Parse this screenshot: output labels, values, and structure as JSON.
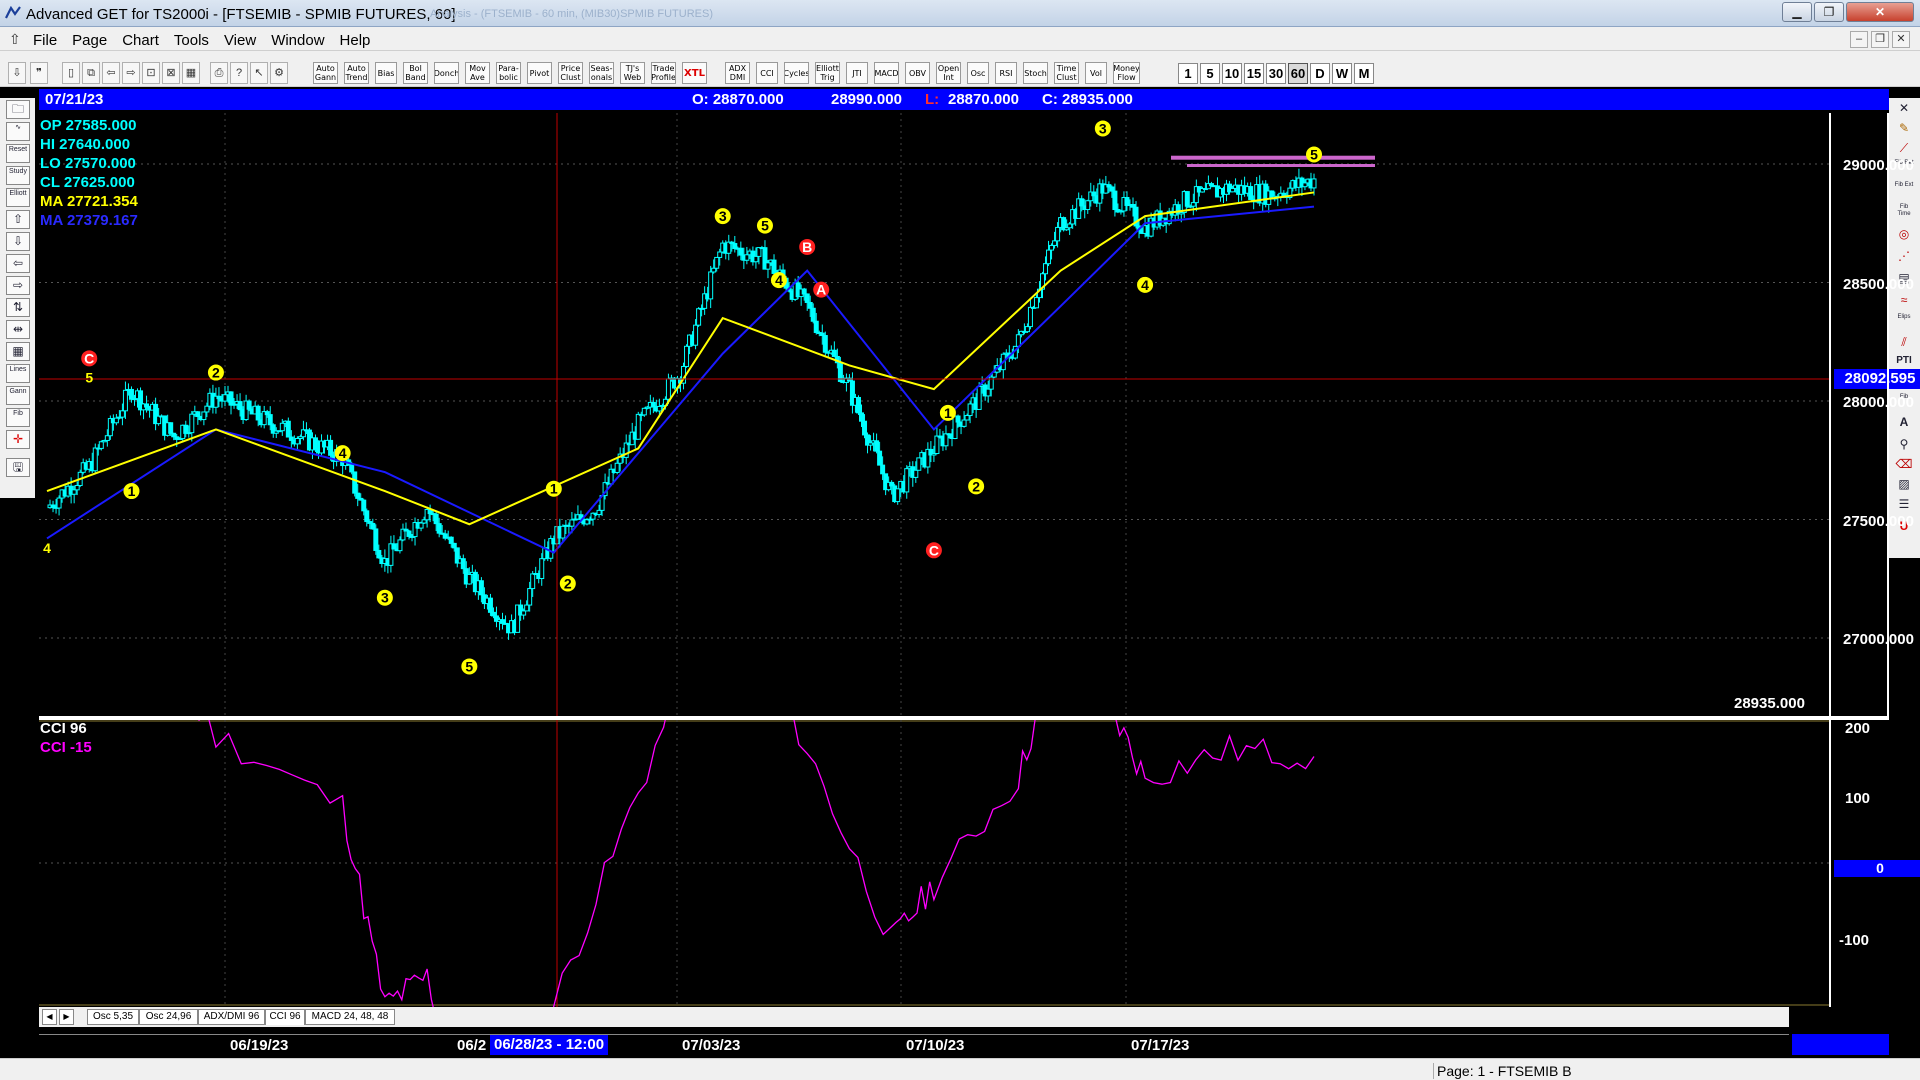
{
  "window": {
    "title": "Advanced GET for TS2000i - [FTSEMIB - SPMIB FUTURES, 60]",
    "ghost_title": "Analysis - (FTSEMIB - 60 min, (MIB30)SPMIB FUTURES)"
  },
  "menu": [
    "File",
    "Page",
    "Chart",
    "Tools",
    "View",
    "Window",
    "Help"
  ],
  "toolbar": {
    "study_buttons": [
      "Auto Gann",
      "Auto Trend",
      "Bias",
      "Bol Band",
      "Donch",
      "Mov Ave",
      "Para-bolic",
      "Pivot",
      "Price Clust",
      "Seas-onals",
      "TJ's Web",
      "Trade Profile",
      "XTL",
      "ADX DMI",
      "CCI",
      "Cycles",
      "Elliott Trig",
      "JTI",
      "MACD",
      "OBV",
      "Open Int",
      "Osc",
      "RSI",
      "Stoch",
      "Time Clust",
      "Vol",
      "Money Flow"
    ],
    "timeframes": [
      "1",
      "5",
      "10",
      "15",
      "30",
      "60",
      "D",
      "W",
      "M"
    ],
    "active_timeframe": "60"
  },
  "left_tools": [
    "Elliott",
    "Reset",
    "Study",
    "Lines",
    "Gann",
    "Fib"
  ],
  "right_tools": [
    "Fib Ret",
    "Fib Ext",
    "Fib Time",
    "Elips",
    "PTI",
    "Fib",
    "A",
    "U"
  ],
  "header": {
    "date": "07/21/23",
    "open": "O: 28870.000",
    "high": "28990.000",
    "low_prefix": "L:",
    "low": "28870.000",
    "close": "C: 28935.000"
  },
  "ohlc_readout": {
    "op": "OP  27585.000",
    "hi": "HI   27640.000",
    "lo": "LO  27570.000",
    "cl": "CL  27625.000",
    "ma_yellow": "MA  27721.354",
    "ma_blue": "MA  27379.167"
  },
  "price_axis": {
    "labels": [
      "29000.000",
      "28500.000",
      "28000.000",
      "27500.000",
      "27000.000"
    ],
    "crosshair_price": "28092.595",
    "last_close": "28935.000"
  },
  "indicator": {
    "title_1": "CCI 96",
    "title_2": "CCI  -15",
    "axis_labels": [
      "200",
      "100",
      "-100"
    ],
    "zero_label": "0"
  },
  "tabs": {
    "nav_prev": "◀",
    "nav_next": "▶",
    "items": [
      "Osc 5,35",
      "Osc 24,96",
      "ADX/DMI 96",
      "CCI 96",
      "MACD 24, 48, 48"
    ],
    "active": "CCI 96"
  },
  "date_axis": {
    "labels": [
      "06/19/23",
      "06/2",
      "07/03/23",
      "07/10/23",
      "07/17/23"
    ],
    "cursor": "06/28/23 - 12:00"
  },
  "status": {
    "page": "Page: 1 - FTSEMIB B"
  },
  "colors": {
    "background": "#000000",
    "price_bars": "#00ffff",
    "ma_fast": "#ffff00",
    "ma_slow": "#1a1aff",
    "cci": "#ff00ff",
    "header": "#0000ff",
    "elliott_labels": "#ffff00",
    "abc_labels": "#ff2020"
  },
  "chart_data": {
    "type": "candlestick",
    "symbol": "FTSEMIB",
    "interval": "60",
    "y_axis_ticks": [
      29000,
      28500,
      28000,
      27500,
      27000
    ],
    "x_axis_ticks": [
      "06/19/23",
      "07/03/23",
      "07/10/23",
      "07/17/23"
    ],
    "price_path": [
      [
        "06/14/23",
        27550
      ],
      [
        "06/15/23",
        27720
      ],
      [
        "06/16/23",
        28050
      ],
      [
        "06/16/23b",
        27850
      ],
      [
        "06/19/23",
        28020
      ],
      [
        "06/20/23",
        27930
      ],
      [
        "06/21/23",
        27850
      ],
      [
        "06/22/23",
        27760
      ],
      [
        "06/23/23",
        27320
      ],
      [
        "06/26/23",
        27550
      ],
      [
        "06/27/23",
        27250
      ],
      [
        "06/27/23b",
        27040
      ],
      [
        "06/28/23",
        27420
      ],
      [
        "06/29/23",
        27550
      ],
      [
        "06/30/23",
        27900
      ],
      [
        "07/01/23",
        28120
      ],
      [
        "07/03/23",
        28660
      ],
      [
        "07/04/23",
        28600
      ],
      [
        "07/05/23",
        28400
      ],
      [
        "07/06/23",
        28050
      ],
      [
        "07/07/23",
        27600
      ],
      [
        "07/10/23",
        27800
      ],
      [
        "07/11/23",
        28000
      ],
      [
        "07/12/23",
        28250
      ],
      [
        "07/13/23",
        28750
      ],
      [
        "07/14/23",
        28900
      ],
      [
        "07/17/23",
        28730
      ],
      [
        "07/18/23",
        28850
      ],
      [
        "07/19/23",
        28900
      ],
      [
        "07/20/23",
        28870
      ],
      [
        "07/21/23",
        28935
      ]
    ],
    "ma_fast_path": [
      [
        "06/14/23",
        27620
      ],
      [
        "06/19/23",
        27880
      ],
      [
        "06/23/23",
        27620
      ],
      [
        "06/27/23",
        27480
      ],
      [
        "06/30/23",
        27800
      ],
      [
        "07/03/23",
        28350
      ],
      [
        "07/06/23",
        28150
      ],
      [
        "07/10/23",
        28050
      ],
      [
        "07/13/23",
        28550
      ],
      [
        "07/17/23",
        28780
      ],
      [
        "07/21/23",
        28880
      ]
    ],
    "ma_slow_path": [
      [
        "06/14/23",
        27420
      ],
      [
        "06/19/23",
        27880
      ],
      [
        "06/23/23",
        27700
      ],
      [
        "06/28/23",
        27360
      ],
      [
        "07/03/23",
        28200
      ],
      [
        "07/05/23",
        28550
      ],
      [
        "07/10/23",
        27880
      ],
      [
        "07/13/23",
        28400
      ],
      [
        "07/17/23",
        28750
      ],
      [
        "07/21/23",
        28820
      ]
    ],
    "cci_path": [
      [
        "06/14/23",
        115
      ],
      [
        "06/16/23",
        170
      ],
      [
        "06/19/23",
        90
      ],
      [
        "06/22/23",
        40
      ],
      [
        "06/23/23",
        -100
      ],
      [
        "06/26/23",
        -80
      ],
      [
        "06/27/23",
        -190
      ],
      [
        "06/28/23",
        -100
      ],
      [
        "06/30/23",
        50
      ],
      [
        "07/03/23",
        205
      ],
      [
        "07/05/23",
        80
      ],
      [
        "07/07/23",
        -55
      ],
      [
        "07/10/23",
        -15
      ],
      [
        "07/12/23",
        60
      ],
      [
        "07/13/23",
        160
      ],
      [
        "07/14/23",
        120
      ],
      [
        "07/17/23",
        60
      ],
      [
        "07/19/23",
        80
      ],
      [
        "07/21/23",
        75
      ]
    ],
    "indicator_y_ticks": [
      200,
      100,
      0,
      -100
    ],
    "elliott_labels": [
      {
        "t": "06/14/23",
        "price": 27380,
        "label": "4",
        "style": "plain"
      },
      {
        "t": "06/15/23",
        "price": 28100,
        "label": "5",
        "style": "plain"
      },
      {
        "t": "06/15/23",
        "price": 28180,
        "label": "C",
        "style": "red-circle"
      },
      {
        "t": "06/16/23",
        "price": 27620,
        "label": "1",
        "style": "circle"
      },
      {
        "t": "06/19/23",
        "price": 28120,
        "label": "2",
        "style": "circle"
      },
      {
        "t": "06/22/23",
        "price": 27780,
        "label": "4",
        "style": "circle"
      },
      {
        "t": "06/23/23",
        "price": 27170,
        "label": "3",
        "style": "circle"
      },
      {
        "t": "06/27/23",
        "price": 26880,
        "label": "5",
        "style": "circle"
      },
      {
        "t": "06/28/23",
        "price": 27630,
        "label": "1",
        "style": "circle"
      },
      {
        "t": "06/28/23b",
        "price": 27230,
        "label": "2",
        "style": "circle"
      },
      {
        "t": "07/03/23",
        "price": 28780,
        "label": "3",
        "style": "circle"
      },
      {
        "t": "07/04/23",
        "price": 28740,
        "label": "5",
        "style": "circle"
      },
      {
        "t": "07/04/23b",
        "price": 28510,
        "label": "4",
        "style": "circle"
      },
      {
        "t": "07/05/23",
        "price": 28650,
        "label": "B",
        "style": "red-circle"
      },
      {
        "t": "07/05/23b",
        "price": 28470,
        "label": "A",
        "style": "red-circle"
      },
      {
        "t": "07/10/23",
        "price": 27370,
        "label": "C",
        "style": "red-circle"
      },
      {
        "t": "07/10/23b",
        "price": 27950,
        "label": "1",
        "style": "circle"
      },
      {
        "t": "07/11/23",
        "price": 27640,
        "label": "2",
        "style": "circle"
      },
      {
        "t": "07/14/23",
        "price": 29150,
        "label": "3",
        "style": "circle"
      },
      {
        "t": "07/17/23",
        "price": 28490,
        "label": "4",
        "style": "circle"
      },
      {
        "t": "07/21/23",
        "price": 29040,
        "label": "5",
        "style": "circle"
      }
    ]
  }
}
